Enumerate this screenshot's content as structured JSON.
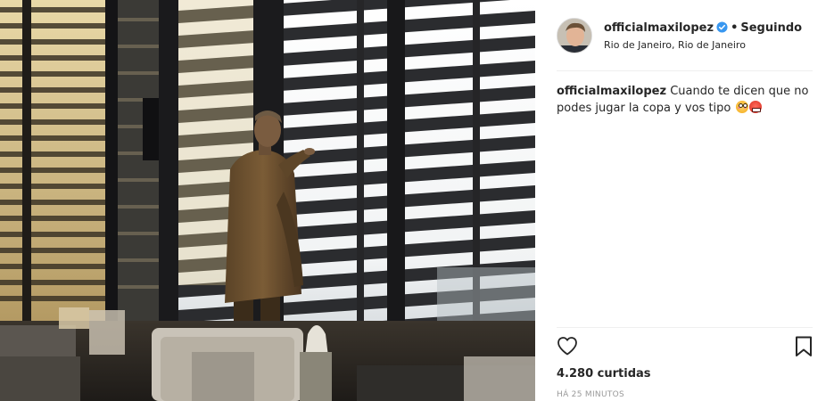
{
  "post": {
    "photo_name": "post-photo",
    "header": {
      "username": "officialmaxilopez",
      "verified_icon": "verified-badge-icon",
      "separator": "•",
      "follow_status": "Seguindo",
      "location": "Rio de Janeiro, Rio de Janeiro"
    },
    "caption": {
      "username": "officialmaxilopez",
      "text": "Cuando te dicen que no podes jugar la copa y vos tipo",
      "emojis": [
        "flushed-face-emoji",
        "angry-face-emoji"
      ]
    },
    "actions": {
      "like_icon": "heart-icon",
      "save_icon": "bookmark-icon"
    },
    "likes": "4.280 curtidas",
    "timestamp": "HÁ 25 MINUTOS"
  },
  "colors": {
    "verified": "#3897f0",
    "text": "#262626",
    "muted": "#999999",
    "divider": "#efefef"
  }
}
